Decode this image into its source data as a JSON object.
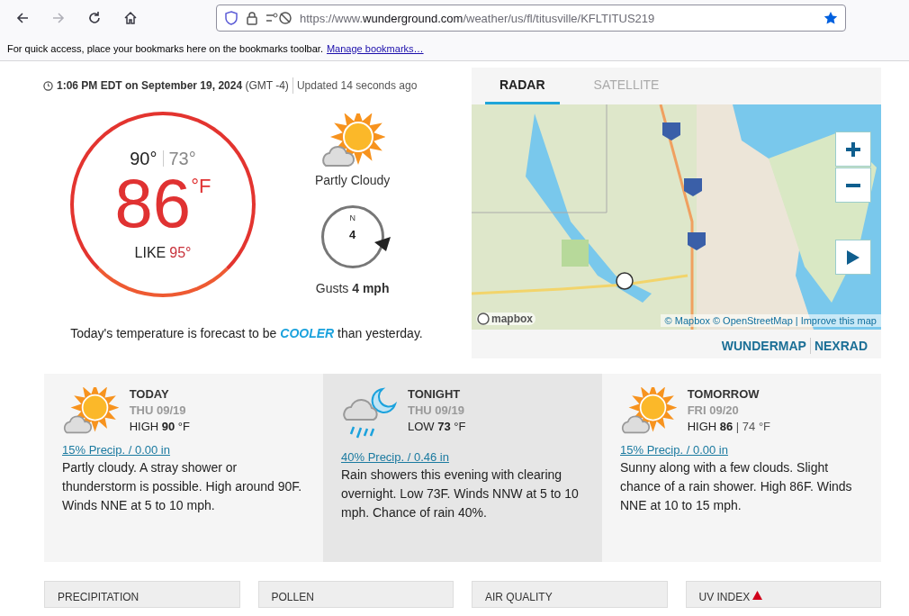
{
  "browser": {
    "nav": [
      {
        "kind": "back",
        "disabled": false
      },
      {
        "kind": "forward",
        "disabled": true
      },
      {
        "kind": "reload",
        "disabled": false
      },
      {
        "kind": "home",
        "disabled": false
      }
    ],
    "url": {
      "scheme": "https://www.",
      "host": "wunderground.com",
      "path": "/weather/us/fl/titusville/KFLTITUS219"
    },
    "bookmarked": true,
    "bookmarks_bar": {
      "message": "For quick access, place your bookmarks here on the bookmarks toolbar.",
      "link": "Manage bookmarks…"
    }
  },
  "current": {
    "timestamp": "**1:06 PM EDT on September 19, 2024** (GMT -4)",
    "updated": "Updated 14 seconds ago",
    "high": "90°",
    "low": "73°",
    "temp": "86",
    "unit": "°F",
    "feels_label": "LIKE",
    "feels": "95°",
    "condition": "Partly Cloudy",
    "wind": {
      "direction": "N",
      "speed": "4",
      "gusts": "Gusts **4 mph**"
    },
    "comparison": "Today's temperature is forecast to be **COOLER** than yesterday."
  },
  "map": {
    "tabs": [
      {
        "label": "RADAR",
        "selected": true
      },
      {
        "label": "SATELLITE",
        "selected": false
      }
    ],
    "logo": "mapbox",
    "attribution": "© Mapbox © OpenStreetMap",
    "attribution_separator": "|",
    "improve": "Improve this map",
    "links": [
      "WUNDERMAP",
      "NEXRAD"
    ]
  },
  "forecast": [
    {
      "period": "TODAY",
      "date": "THU 09/19",
      "selected": false,
      "kind": "sun-cloud",
      "temp_label": "HIGH",
      "temp": "90",
      "unit": "°F",
      "precip": "15% Precip. / 0.00 in",
      "description": "Partly cloudy. A stray shower or thunderstorm is possible. High around 90F. Winds NNE at 5 to 10 mph."
    },
    {
      "period": "TONIGHT",
      "date": "THU 09/19",
      "selected": true,
      "kind": "moon-rain",
      "temp_label": "LOW",
      "temp": "73",
      "unit": "°F",
      "precip": "40% Precip. / 0.46 in",
      "description": "Rain showers this evening with clearing overnight. Low 73F. Winds NNW at 5 to 10 mph. Chance of rain 40%."
    },
    {
      "period": "TOMORROW",
      "date": "FRI 09/20",
      "selected": false,
      "kind": "sun-cloud",
      "temp_label": "HIGH",
      "temp": "86",
      "low": "| 74 °F",
      "precip": "15% Precip. / 0.00 in",
      "description": "Sunny along with a few clouds. Slight chance of a rain shower. High 86F. Winds NNE at 10 to 15 mph."
    }
  ],
  "cards": [
    {
      "title": "PRECIPITATION",
      "alert": false
    },
    {
      "title": "POLLEN",
      "alert": false
    },
    {
      "title": "AIR QUALITY",
      "alert": false
    },
    {
      "title": "UV INDEX",
      "alert": true
    }
  ]
}
